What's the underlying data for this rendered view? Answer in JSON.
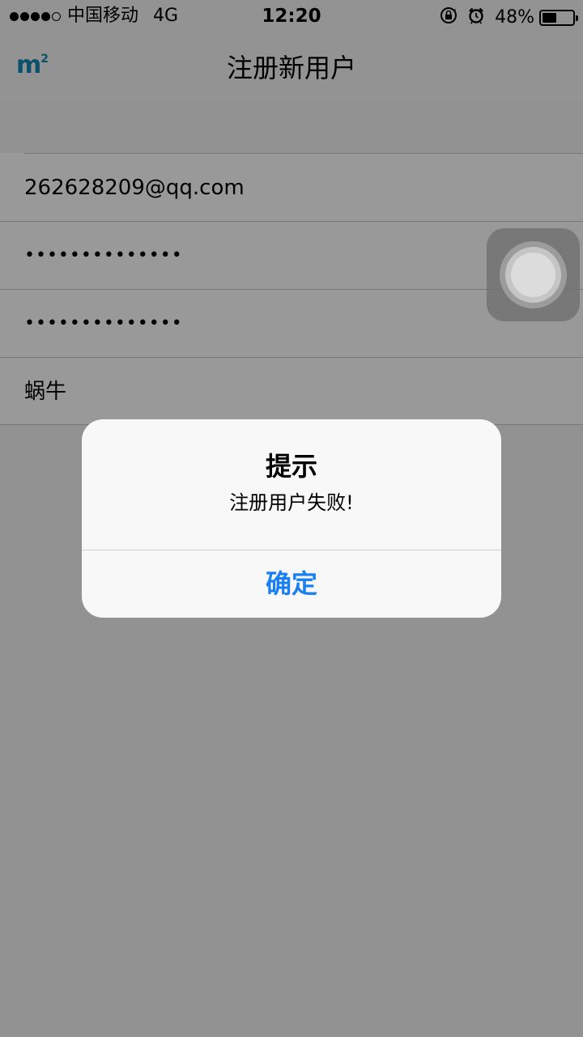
{
  "status_bar": {
    "signal_bars_filled": 4,
    "signal_bars_total": 5,
    "carrier": "中国移动",
    "network": "4G",
    "time": "12:20",
    "battery_percent_label": "48%",
    "battery_level": 0.48,
    "icons": [
      "orientation-lock-icon",
      "alarm-icon"
    ]
  },
  "nav": {
    "logo_text": "m",
    "logo_superscript": "2",
    "title": "注册新用户"
  },
  "form": {
    "email": "262628209@qq.com",
    "password": "••••••••••••••",
    "password_confirm": "••••••••••••••",
    "nickname": "蜗牛"
  },
  "alert": {
    "title": "提示",
    "message": "注册用户失败!",
    "confirm_label": "确定"
  },
  "colors": {
    "accent": "#1a7ff0",
    "logo": "#1388b5"
  }
}
